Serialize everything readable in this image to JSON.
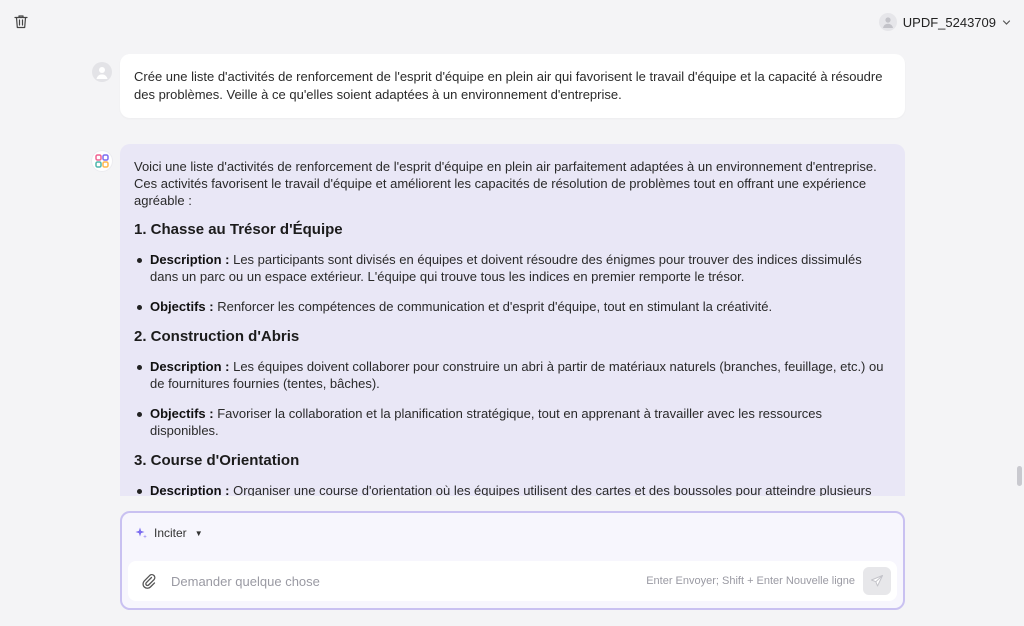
{
  "header": {
    "trash_icon": "trash-icon",
    "user_name": "UPDF_5243709",
    "chevron_icon": "chevron-down-icon"
  },
  "conversation": {
    "user_message": "Crée une liste d'activités de renforcement de l'esprit d'équipe en plein air qui favorisent le travail d'équipe et la capacité à résoudre des problèmes. Veille à ce qu'elles soient adaptées à un environnement d'entreprise.",
    "ai_intro": "Voici une liste d'activités de renforcement de l'esprit d'équipe en plein air parfaitement adaptées à un environnement d'entreprise. Ces activités favorisent le travail d'équipe et améliorent les capacités de résolution de problèmes tout en offrant une expérience agréable :",
    "sections": [
      {
        "heading": "1. Chasse au Trésor d'Équipe",
        "items": [
          {
            "label": "Description :",
            "text": "Les participants sont divisés en équipes et doivent résoudre des énigmes pour trouver des indices dissimulés dans un parc ou un espace extérieur. L'équipe qui trouve tous les indices en premier remporte le trésor."
          },
          {
            "label": "Objectifs :",
            "text": "Renforcer les compétences de communication et d'esprit d'équipe, tout en stimulant la créativité."
          }
        ]
      },
      {
        "heading": "2. Construction d'Abris",
        "items": [
          {
            "label": "Description :",
            "text": "Les équipes doivent collaborer pour construire un abri à partir de matériaux naturels (branches, feuillage, etc.) ou de fournitures fournies (tentes, bâches)."
          },
          {
            "label": "Objectifs :",
            "text": "Favoriser la collaboration et la planification stratégique, tout en apprenant à travailler avec les ressources disponibles."
          }
        ]
      },
      {
        "heading": "3. Course d'Orientation",
        "items": [
          {
            "label": "Description :",
            "text": "Organiser une course d'orientation où les équipes utilisent des cartes et des boussoles pour atteindre plusieurs points de contrôle."
          }
        ]
      }
    ]
  },
  "composer": {
    "prompt_label": "Inciter",
    "placeholder": "Demander quelque chose",
    "hint": "Enter Envoyer; Shift + Enter Nouvelle ligne"
  },
  "colors": {
    "ai_bubble": "#e9e7f6",
    "composer_border": "#c9c1f1",
    "accent": "#7b6cf0"
  }
}
